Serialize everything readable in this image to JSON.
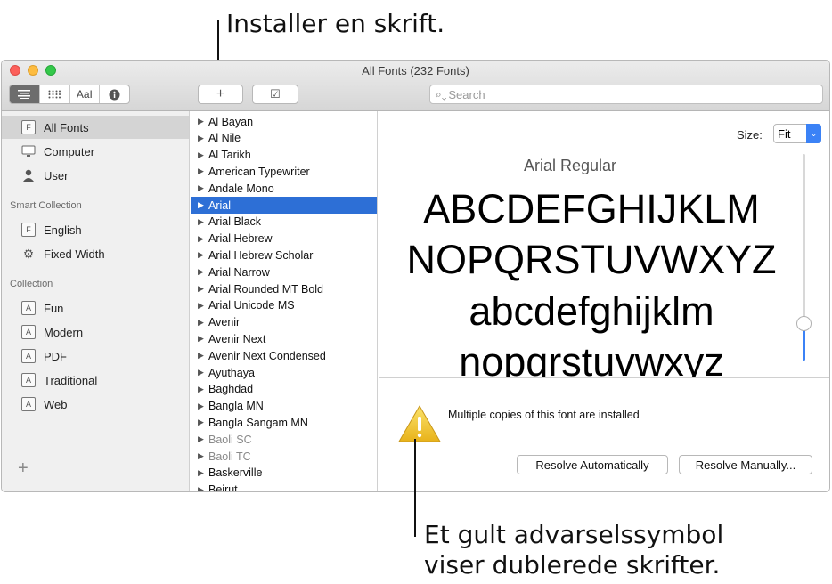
{
  "callouts": {
    "top": "Installer en skrift.",
    "bottom_line1": "Et gult advarselssymbol",
    "bottom_line2": "viser dublerede skrifter."
  },
  "window": {
    "title": "All Fonts (232 Fonts)"
  },
  "toolbar": {
    "view_buttons": [
      {
        "icon": "list-view-icon"
      },
      {
        "icon": "grid-view-icon"
      },
      {
        "label": "AaI",
        "icon": "sample-view-icon"
      },
      {
        "icon": "info-icon"
      }
    ],
    "add_label": "+",
    "validate_label": "☑",
    "search_placeholder": "Search"
  },
  "sidebar": {
    "items": [
      {
        "label": "All Fonts",
        "icon": "F"
      },
      {
        "label": "Computer",
        "icon": "computer-icon"
      },
      {
        "label": "User",
        "icon": "user-icon"
      }
    ],
    "smart_header": "Smart Collection",
    "smart_items": [
      {
        "label": "English",
        "icon": "F"
      },
      {
        "label": "Fixed Width",
        "icon": "gear-icon"
      }
    ],
    "collection_header": "Collection",
    "collections": [
      {
        "label": "Fun",
        "icon": "A"
      },
      {
        "label": "Modern",
        "icon": "A"
      },
      {
        "label": "PDF",
        "icon": "A"
      },
      {
        "label": "Traditional",
        "icon": "A"
      },
      {
        "label": "Web",
        "icon": "A"
      }
    ],
    "add_label": "+"
  },
  "fonts": [
    {
      "name": "Al Bayan"
    },
    {
      "name": "Al Nile"
    },
    {
      "name": "Al Tarikh"
    },
    {
      "name": "American Typewriter"
    },
    {
      "name": "Andale Mono"
    },
    {
      "name": "Arial",
      "selected": true
    },
    {
      "name": "Arial Black"
    },
    {
      "name": "Arial Hebrew"
    },
    {
      "name": "Arial Hebrew Scholar"
    },
    {
      "name": "Arial Narrow"
    },
    {
      "name": "Arial Rounded MT Bold"
    },
    {
      "name": "Arial Unicode MS"
    },
    {
      "name": "Avenir"
    },
    {
      "name": "Avenir Next"
    },
    {
      "name": "Avenir Next Condensed"
    },
    {
      "name": "Ayuthaya"
    },
    {
      "name": "Baghdad"
    },
    {
      "name": "Bangla MN"
    },
    {
      "name": "Bangla Sangam MN"
    },
    {
      "name": "Baoli SC",
      "dim": true
    },
    {
      "name": "Baoli TC",
      "dim": true
    },
    {
      "name": "Baskerville"
    },
    {
      "name": "Beirut"
    }
  ],
  "preview": {
    "size_label": "Size:",
    "size_value": "Fit",
    "face_name": "Arial Regular",
    "lines": [
      "ABCDEFGHIJKLM",
      "NOPQRSTUVWXYZ",
      "abcdefghijklm",
      "nopqrstuvwxyz"
    ],
    "size_slider_value": 0.2
  },
  "warning": {
    "message": "Multiple copies of this font are installed",
    "resolve_auto": "Resolve Automatically",
    "resolve_manual": "Resolve Manually..."
  },
  "colors": {
    "selection": "#2d6fd6",
    "accent": "#3b82f6",
    "warning": "#f5c518"
  }
}
